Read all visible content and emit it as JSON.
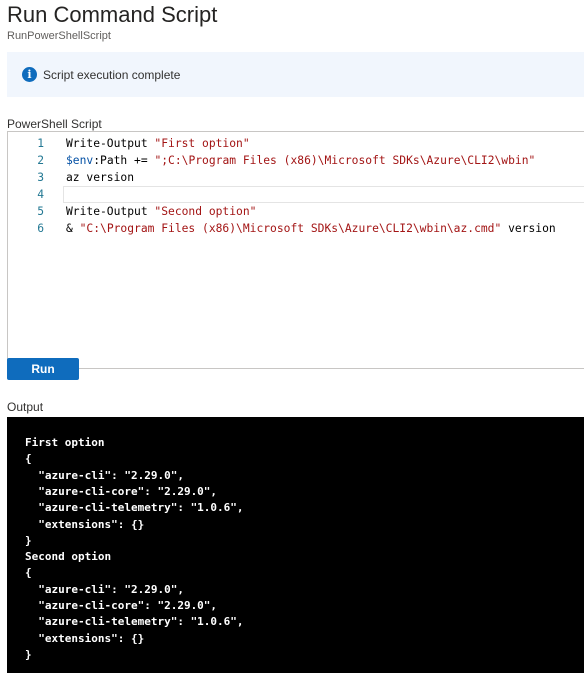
{
  "header": {
    "title": "Run Command Script",
    "subtitle": "RunPowerShellScript"
  },
  "info": {
    "icon": "info-icon",
    "message": "Script execution complete"
  },
  "script": {
    "label": "PowerShell Script",
    "lines": [
      {
        "num": "1",
        "parts": [
          {
            "text": "Write-Output ",
            "cls": ""
          },
          {
            "text": "\"First option\"",
            "cls": "str"
          }
        ]
      },
      {
        "num": "2",
        "parts": [
          {
            "text": "$env",
            "cls": "var"
          },
          {
            "text": ":Path += ",
            "cls": ""
          },
          {
            "text": "\";C:\\Program Files (x86)\\Microsoft SDKs\\Azure\\CLI2\\wbin\"",
            "cls": "str"
          }
        ]
      },
      {
        "num": "3",
        "parts": [
          {
            "text": "az version",
            "cls": ""
          }
        ]
      },
      {
        "num": "4",
        "parts": []
      },
      {
        "num": "5",
        "parts": [
          {
            "text": "Write-Output ",
            "cls": ""
          },
          {
            "text": "\"Second option\"",
            "cls": "str"
          }
        ]
      },
      {
        "num": "6",
        "parts": [
          {
            "text": "& ",
            "cls": ""
          },
          {
            "text": "\"C:\\Program Files (x86)\\Microsoft SDKs\\Azure\\CLI2\\wbin\\az.cmd\"",
            "cls": "str"
          },
          {
            "text": " version",
            "cls": ""
          }
        ]
      }
    ],
    "current_line": "4"
  },
  "run_button": {
    "label": "Run"
  },
  "output": {
    "label": "Output",
    "lines": [
      "First option",
      "{",
      "  \"azure-cli\": \"2.29.0\",",
      "  \"azure-cli-core\": \"2.29.0\",",
      "  \"azure-cli-telemetry\": \"1.0.6\",",
      "  \"extensions\": {}",
      "}",
      "Second option",
      "{",
      "  \"azure-cli\": \"2.29.0\",",
      "  \"azure-cli-core\": \"2.29.0\",",
      "  \"azure-cli-telemetry\": \"1.0.6\",",
      "  \"extensions\": {}",
      "}"
    ]
  }
}
